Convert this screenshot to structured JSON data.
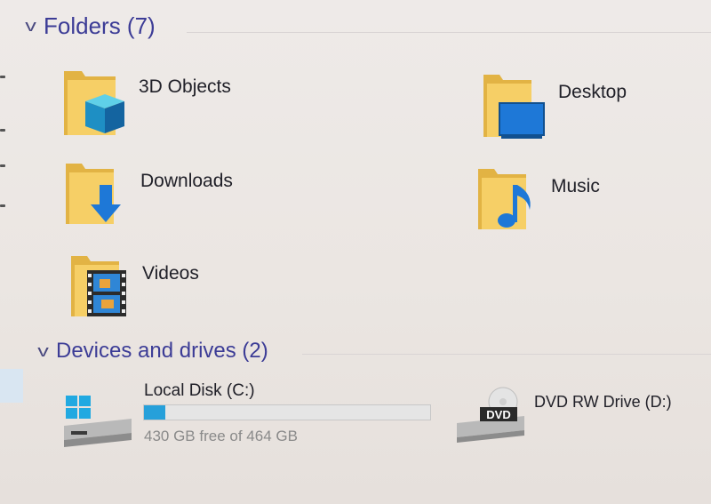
{
  "folders_group": {
    "title": "Folders (7)",
    "items": [
      {
        "label": "3D Objects",
        "icon": "3d-objects-folder-icon"
      },
      {
        "label": "Desktop",
        "icon": "desktop-folder-icon"
      },
      {
        "label": "Downloads",
        "icon": "downloads-folder-icon"
      },
      {
        "label": "Music",
        "icon": "music-folder-icon"
      },
      {
        "label": "Videos",
        "icon": "videos-folder-icon"
      }
    ]
  },
  "devices_group": {
    "title": "Devices and drives (2)",
    "drives": [
      {
        "name": "Local Disk (C:)",
        "free_text": "430 GB free of 464 GB",
        "used_fraction": 0.073,
        "icon": "windows-drive-icon"
      },
      {
        "name": "DVD RW Drive (D:)",
        "icon": "dvd-drive-icon",
        "badge": "DVD"
      }
    ]
  },
  "colors": {
    "header_text": "#3c3c96",
    "folder_yellow": "#f4c95d",
    "accent_blue": "#1e78d7",
    "progress_fill": "#26a0da"
  }
}
